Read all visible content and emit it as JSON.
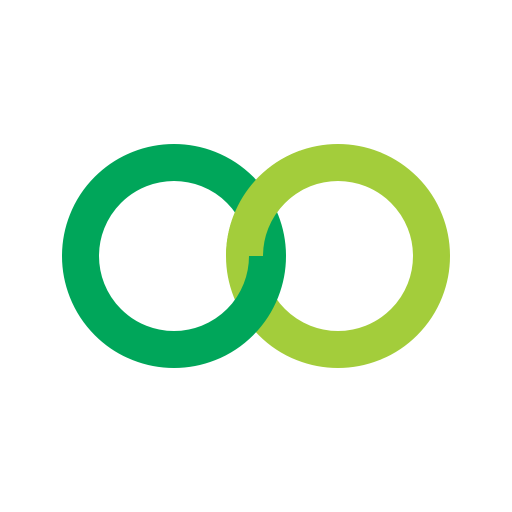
{
  "logo": {
    "icon": "interlocking-rings-icon",
    "colors": {
      "background": "#ffffff",
      "left_ring": "#00a65a",
      "right_ring": "#a3cd3b"
    }
  }
}
